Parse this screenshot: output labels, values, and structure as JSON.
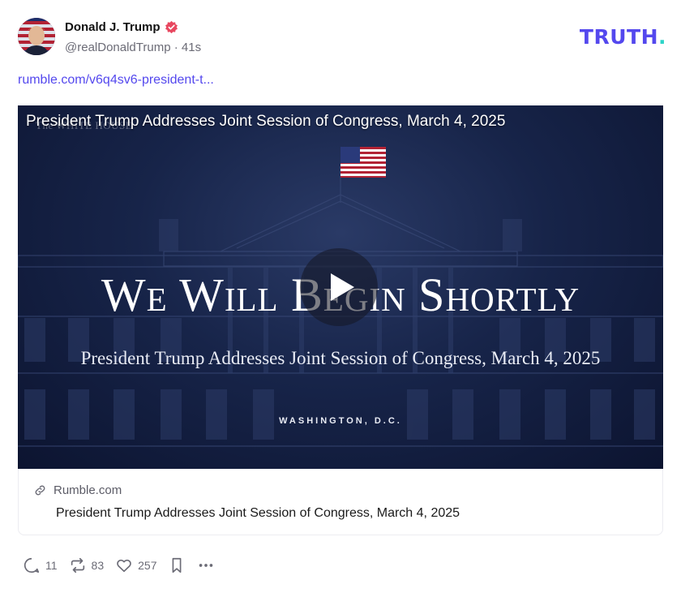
{
  "post": {
    "author": {
      "display_name": "Donald J. Trump",
      "handle_line": "@realDonaldTrump · 41s"
    },
    "link_text": "rumble.com/v6q4sv6-president-t..."
  },
  "brand": {
    "logo_main": "TRUTH",
    "logo_dot": ".",
    "primary_color": "#5448ee",
    "dot_color": "#2dd4c8"
  },
  "video": {
    "overlay_title": "President Trump Addresses Joint Session of Congress, March 4, 2025",
    "watermark": "The WHITE HOUSE",
    "headline": "We Will Begin Shortly",
    "subline": "President Trump Addresses Joint Session of Congress, March 4, 2025",
    "location": "WASHINGTON, D.C."
  },
  "card": {
    "source": "Rumble.com",
    "title": "President Trump Addresses Joint Session of Congress, March 4, 2025"
  },
  "actions": {
    "replies": "11",
    "retruths": "83",
    "likes": "257"
  },
  "icons": [
    "verified-badge-icon",
    "link-icon",
    "reply-icon",
    "retruth-icon",
    "like-icon",
    "bookmark-icon",
    "more-icon",
    "play-icon",
    "flag-icon"
  ]
}
